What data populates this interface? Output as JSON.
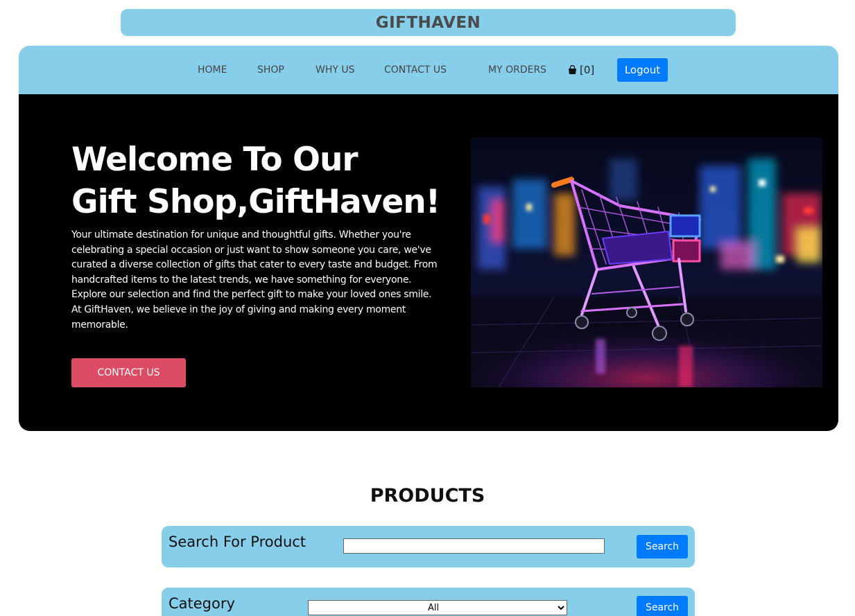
{
  "brand": {
    "title": "GIFTHAVEN"
  },
  "nav": {
    "items": [
      {
        "label": "HOME"
      },
      {
        "label": "SHOP"
      },
      {
        "label": "WHY US"
      },
      {
        "label": "CONTACT US"
      },
      {
        "label": "MY ORDERS"
      }
    ],
    "cart_count": "[0]",
    "cart_icon": "shopping-bag-icon",
    "logout_label": "Logout"
  },
  "hero": {
    "heading_line1": "Welcome To Our",
    "heading_line2": "Gift Shop,GiftHaven!",
    "description": "Your ultimate destination for unique and thoughtful gifts. Whether you're celebrating a special occasion or just want to show someone you care, we've curated a diverse collection of gifts that cater to every taste and budget. From handcrafted items to the latest trends, we have something for everyone. Explore our selection and find the perfect gift to make your loved ones smile. At GiftHaven, we believe in the joy of giving and making every moment memorable.",
    "button_label": "CONTACT US"
  },
  "products": {
    "title": "PRODUCTS",
    "search": {
      "label": "Search For Product",
      "value": "",
      "placeholder": "",
      "button_label": "Search"
    },
    "category": {
      "label": "Category",
      "selected": "All",
      "button_label": "Search"
    }
  },
  "colors": {
    "panel": "#87ceeb",
    "primary": "#007bff",
    "accent": "#dc4c64",
    "hero_bg": "#000000"
  }
}
